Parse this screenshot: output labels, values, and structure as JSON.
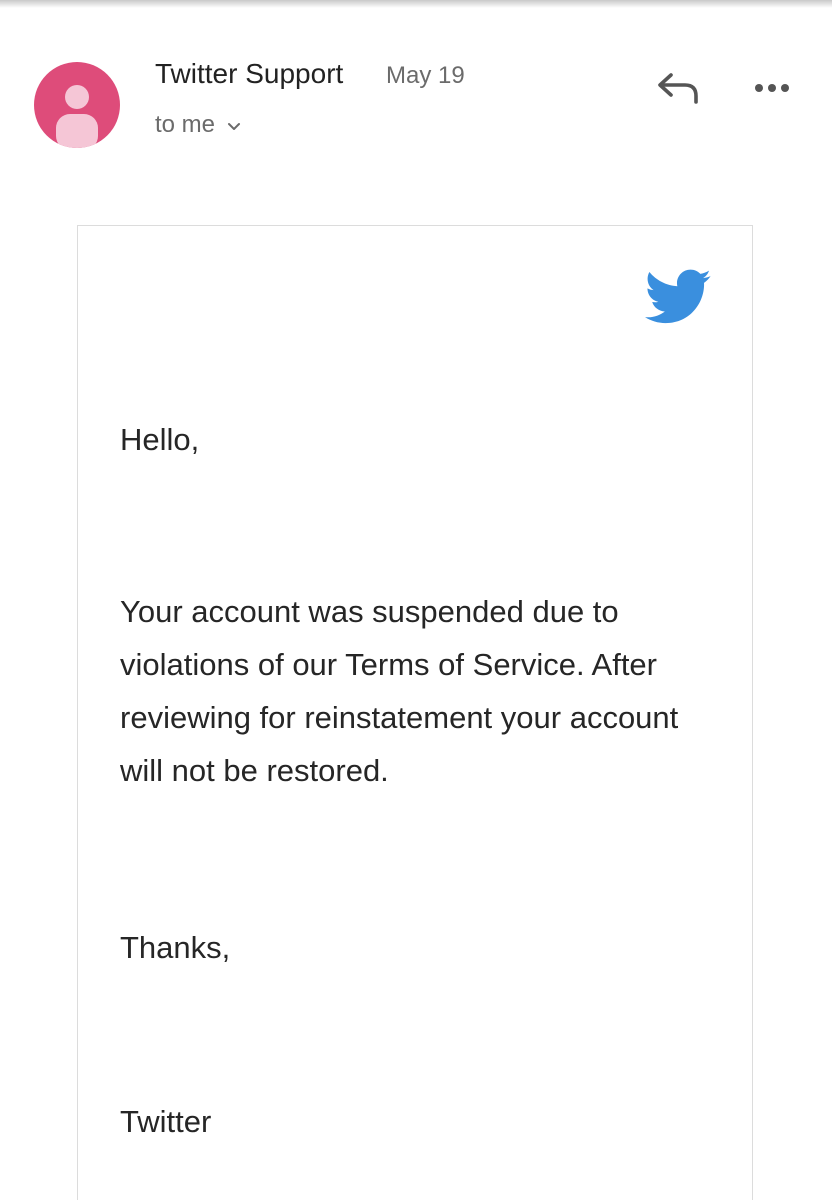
{
  "email": {
    "sender": "Twitter Support",
    "date": "May 19",
    "recipient": "to me",
    "body": {
      "greeting": "Hello,",
      "message": "Your account was suspended due to violations of our Terms of Service. After reviewing for reinstatement your account will not be restored.",
      "signoff": "Thanks,",
      "signature": "Twitter"
    }
  },
  "icons": {
    "avatar": "person-icon",
    "recipient_toggle": "chevron-down-icon",
    "reply": "reply-icon",
    "more": "more-options-icon",
    "brand": "twitter-bird-icon"
  },
  "colors": {
    "avatar_background": "#de4c7a",
    "avatar_figure": "#f5c6d6",
    "brand_blue": "#3a8fde",
    "icon_gray": "#555555",
    "text_primary": "#262626",
    "text_secondary": "#6b6b6b"
  }
}
